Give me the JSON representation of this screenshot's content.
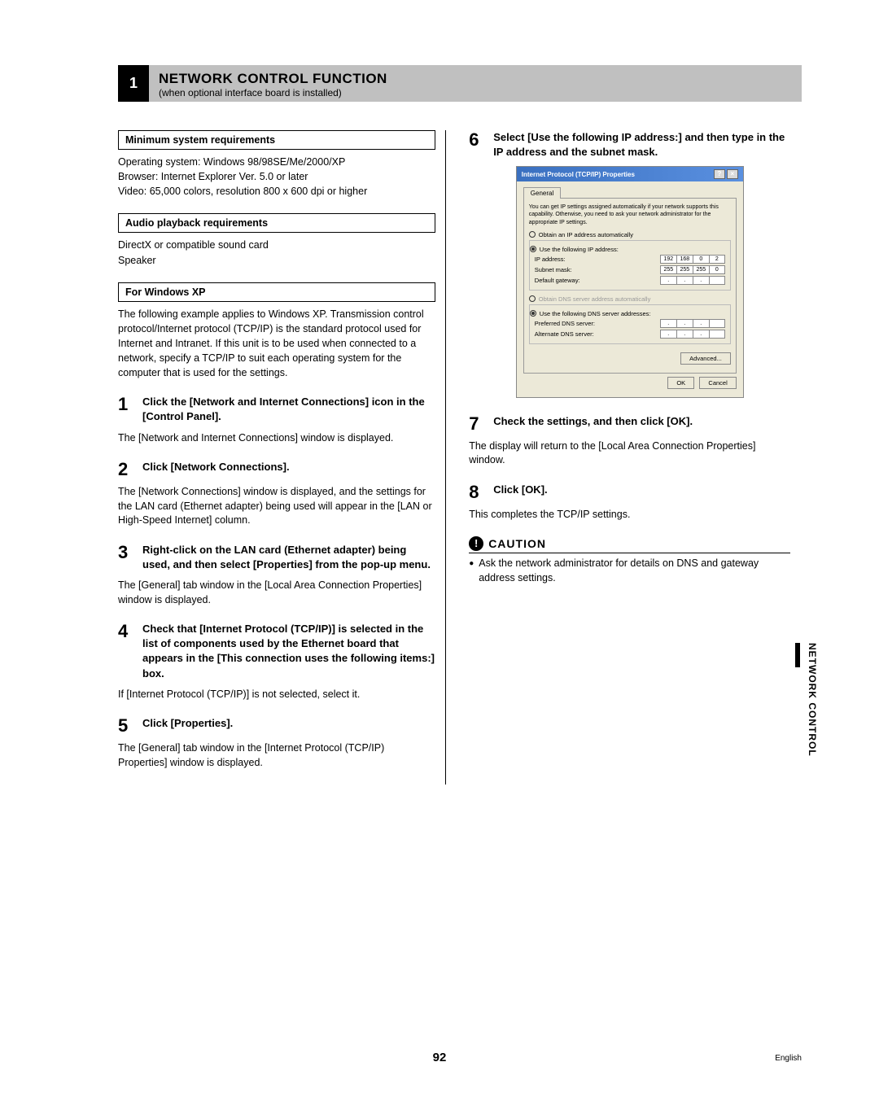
{
  "header": {
    "num": "1",
    "title": "NETWORK CONTROL FUNCTION",
    "sub": "(when optional interface board is installed)"
  },
  "sec1": {
    "heading": "Minimum system requirements",
    "body": "Operating system: Windows 98/98SE/Me/2000/XP\nBrowser: Internet Explorer Ver. 5.0 or later\nVideo: 65,000 colors, resolution 800 x 600 dpi or higher"
  },
  "sec2": {
    "heading": "Audio playback requirements",
    "body": "DirectX or compatible sound card\nSpeaker"
  },
  "sec3": {
    "heading": "For Windows XP",
    "body": "The following example applies to Windows XP.\nTransmission control protocol/Internet protocol (TCP/IP) is the standard protocol used for Internet and Intranet. If this unit is to be used when connected to a network, specify a TCP/IP to suit each operating system for the computer that is used for the settings."
  },
  "steps": [
    {
      "num": "1",
      "title": "Click the [Network and Internet Connections] icon in the [Control Panel].",
      "body": "The [Network and Internet Connections] window is displayed."
    },
    {
      "num": "2",
      "title": "Click [Network Connections].",
      "body": "The [Network Connections] window is displayed, and the settings for the LAN card (Ethernet adapter) being used will appear in the [LAN or High-Speed Internet] column."
    },
    {
      "num": "3",
      "title": "Right-click on the LAN card (Ethernet adapter) being used, and then select [Properties] from the pop-up menu.",
      "body": "The [General] tab window in the [Local Area Connection Properties] window is displayed."
    },
    {
      "num": "4",
      "title": "Check that [Internet Protocol (TCP/IP)] is selected in the list of components used by the Ethernet board that appears in the [This connection uses the following items:] box.",
      "body": "If [Internet Protocol (TCP/IP)] is not selected, select it."
    },
    {
      "num": "5",
      "title": "Click [Properties].",
      "body": "The [General] tab window in the [Internet Protocol (TCP/IP) Properties] window is displayed."
    },
    {
      "num": "6",
      "title": "Select [Use the following IP address:] and then type in the IP address and the subnet mask.",
      "body": ""
    },
    {
      "num": "7",
      "title": "Check the settings, and then click [OK].",
      "body": "The display will return to the [Local Area Connection Properties] window."
    },
    {
      "num": "8",
      "title": "Click [OK].",
      "body": "This completes the TCP/IP settings."
    }
  ],
  "dialog": {
    "title": "Internet Protocol (TCP/IP) Properties",
    "tab": "General",
    "desc": "You can get IP settings assigned automatically if your network supports this capability. Otherwise, you need to ask your network administrator for the appropriate IP settings.",
    "opt_auto": "Obtain an IP address automatically",
    "opt_use": "Use the following IP address:",
    "ip_label": "IP address:",
    "ip_val": [
      "192",
      "168",
      "0",
      "2"
    ],
    "mask_label": "Subnet mask:",
    "mask_val": [
      "255",
      "255",
      "255",
      "0"
    ],
    "gw_label": "Default gateway:",
    "dns_auto": "Obtain DNS server address automatically",
    "dns_use": "Use the following DNS server addresses:",
    "pref_dns": "Preferred DNS server:",
    "alt_dns": "Alternate DNS server:",
    "adv": "Advanced...",
    "ok": "OK",
    "cancel": "Cancel"
  },
  "caution": {
    "title": "CAUTION",
    "body": "Ask the network administrator for details on DNS and gateway address settings."
  },
  "page_num": "92",
  "side": "NETWORK CONTROL",
  "lang": "English"
}
